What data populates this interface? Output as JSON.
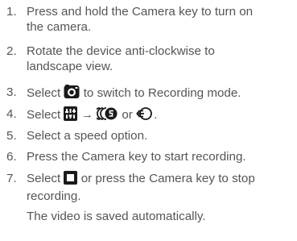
{
  "steps": [
    {
      "num": "1.",
      "lines": [
        "Press and hold the Camera key to turn on",
        "the camera."
      ]
    },
    {
      "num": "2.",
      "lines": [
        "Rotate the device anti-clockwise to",
        "landscape view."
      ]
    },
    {
      "num": "3.",
      "before": "Select",
      "after": "to switch to Recording mode.",
      "icons": [
        "camera-switch-icon"
      ]
    },
    {
      "num": "4.",
      "before": "Select",
      "arrow": "→",
      "middle": "or",
      "end": ".",
      "icons": [
        "settings-icon",
        "fast-speed-icon",
        "slow-speed-icon"
      ]
    },
    {
      "num": "5.",
      "lines": [
        "Select a speed option."
      ]
    },
    {
      "num": "6.",
      "lines": [
        "Press the Camera key to start recording."
      ]
    },
    {
      "num": "7.",
      "before": "Select",
      "after": "or press the Camera key to stop",
      "line2": "recording.",
      "icons": [
        "stop-icon"
      ]
    }
  ],
  "note": "The video is saved automatically.",
  "colors": {
    "text": "#555555",
    "icon_dark": "#1a1a1a",
    "icon_fill": "#ffffff"
  }
}
